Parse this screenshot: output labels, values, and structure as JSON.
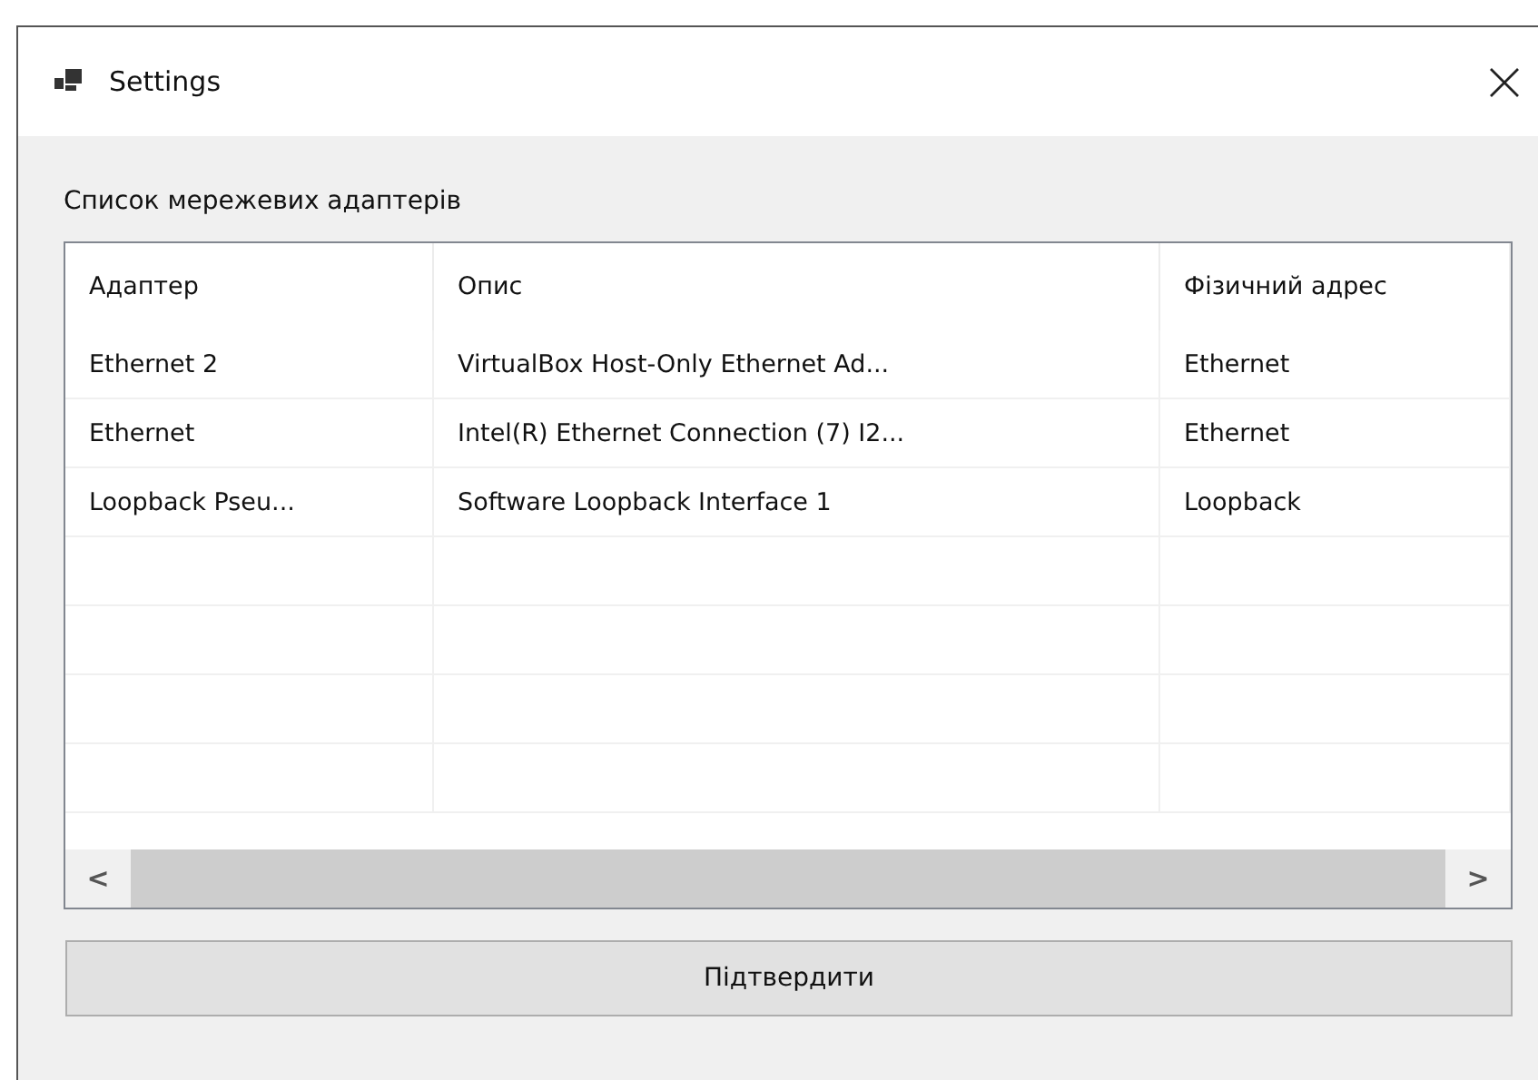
{
  "window": {
    "title": "Settings"
  },
  "list_label": "Список мережевих адаптерів",
  "table": {
    "columns": [
      "Адаптер",
      "Опис",
      "Фізичний адрес"
    ],
    "rows": [
      [
        "Ethernet 2",
        "VirtualBox Host-Only Ethernet Ad...",
        "Ethernet"
      ],
      [
        "Ethernet",
        "Intel(R) Ethernet Connection (7) I2...",
        "Ethernet"
      ],
      [
        "Loopback Pseu...",
        "Software Loopback Interface 1",
        "Loopback"
      ]
    ]
  },
  "scrollbar": {
    "left": "<",
    "right": ">"
  },
  "confirm_button": "Підтвердити"
}
